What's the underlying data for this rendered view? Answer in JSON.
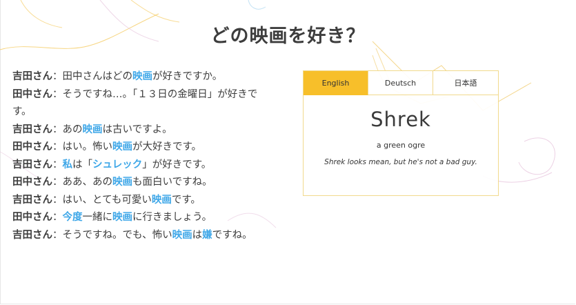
{
  "page": {
    "title": "どの映画を好き？"
  },
  "dialogue": [
    {
      "speaker": "吉田さん",
      "segments": [
        {
          "t": "：田中さんはどの"
        },
        {
          "t": "映画",
          "hl": true
        },
        {
          "t": "が好きですか。"
        }
      ]
    },
    {
      "speaker": "田中さん",
      "segments": [
        {
          "t": "：そうですね…。「１３日の金曜日」が好きです。"
        }
      ]
    },
    {
      "speaker": "吉田さん",
      "segments": [
        {
          "t": "：あの"
        },
        {
          "t": "映画",
          "hl": true
        },
        {
          "t": "は古いですよ。"
        }
      ]
    },
    {
      "speaker": "田中さん",
      "segments": [
        {
          "t": "：はい。怖い"
        },
        {
          "t": "映画",
          "hl": true
        },
        {
          "t": "が大好きです。"
        }
      ]
    },
    {
      "speaker": "吉田さん",
      "segments": [
        {
          "t": "："
        },
        {
          "t": "私",
          "hl": true
        },
        {
          "t": "は「"
        },
        {
          "t": "シュレック",
          "hl": true
        },
        {
          "t": "」が好きです。"
        }
      ]
    },
    {
      "speaker": "田中さん",
      "segments": [
        {
          "t": "：ああ、あの"
        },
        {
          "t": "映画",
          "hl": true
        },
        {
          "t": "も面白いですね。"
        }
      ]
    },
    {
      "speaker": "吉田さん",
      "segments": [
        {
          "t": "：はい、とても可愛い"
        },
        {
          "t": "映画",
          "hl": true
        },
        {
          "t": "です。"
        }
      ]
    },
    {
      "speaker": "田中さん",
      "segments": [
        {
          "t": "："
        },
        {
          "t": "今度",
          "hl": true
        },
        {
          "t": "一緒に"
        },
        {
          "t": "映画",
          "hl": true
        },
        {
          "t": "に行きましょう。"
        }
      ]
    },
    {
      "speaker": "吉田さん",
      "segments": [
        {
          "t": "：そうですね。でも、怖い"
        },
        {
          "t": "映画",
          "hl": true
        },
        {
          "t": "は"
        },
        {
          "t": "嫌",
          "hl": true
        },
        {
          "t": "ですね。"
        }
      ]
    }
  ],
  "card": {
    "tabs": [
      {
        "label": "English",
        "active": true
      },
      {
        "label": "Deutsch",
        "active": false
      },
      {
        "label": "日本語",
        "active": false
      }
    ],
    "term": "Shrek",
    "definition": "a green ogre",
    "example": "Shrek looks mean, but he's not a bad guy."
  },
  "colors": {
    "highlight": "#3ea7e8",
    "tab_active": "#f7bf2a",
    "card_border": "#f1d98c"
  }
}
